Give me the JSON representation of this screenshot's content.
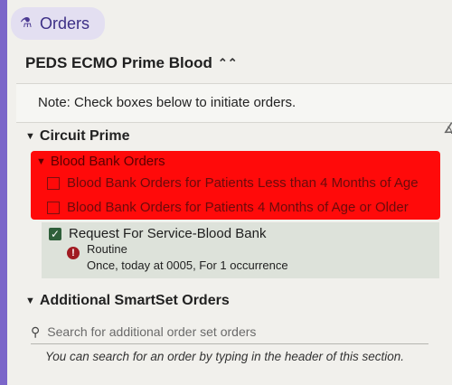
{
  "tab": {
    "label": "Orders",
    "icon": "orders-icon"
  },
  "order_set": {
    "title": "PEDS ECMO Prime Blood",
    "collapse_icon": "double-chevron-up-icon"
  },
  "note": "Note: Check boxes below to initiate orders.",
  "circuit_prime": {
    "header": "Circuit Prime",
    "blood_bank": {
      "header": "Blood Bank Orders",
      "items": [
        "Blood Bank Orders for Patients Less than 4 Months of Age",
        "Blood Bank Orders for Patients 4 Months of Age or Older"
      ],
      "highlight_color": "#ff0a0a"
    },
    "request": {
      "label": "Request For Service-Blood Bank",
      "priority": "Routine",
      "frequency": "Once, today at 0005, For 1 occurrence",
      "checked": true
    }
  },
  "additional": {
    "header": "Additional SmartSet Orders",
    "search_placeholder": "Search for additional order set orders",
    "hint": "You can search for an order by typing in the header of this section."
  }
}
